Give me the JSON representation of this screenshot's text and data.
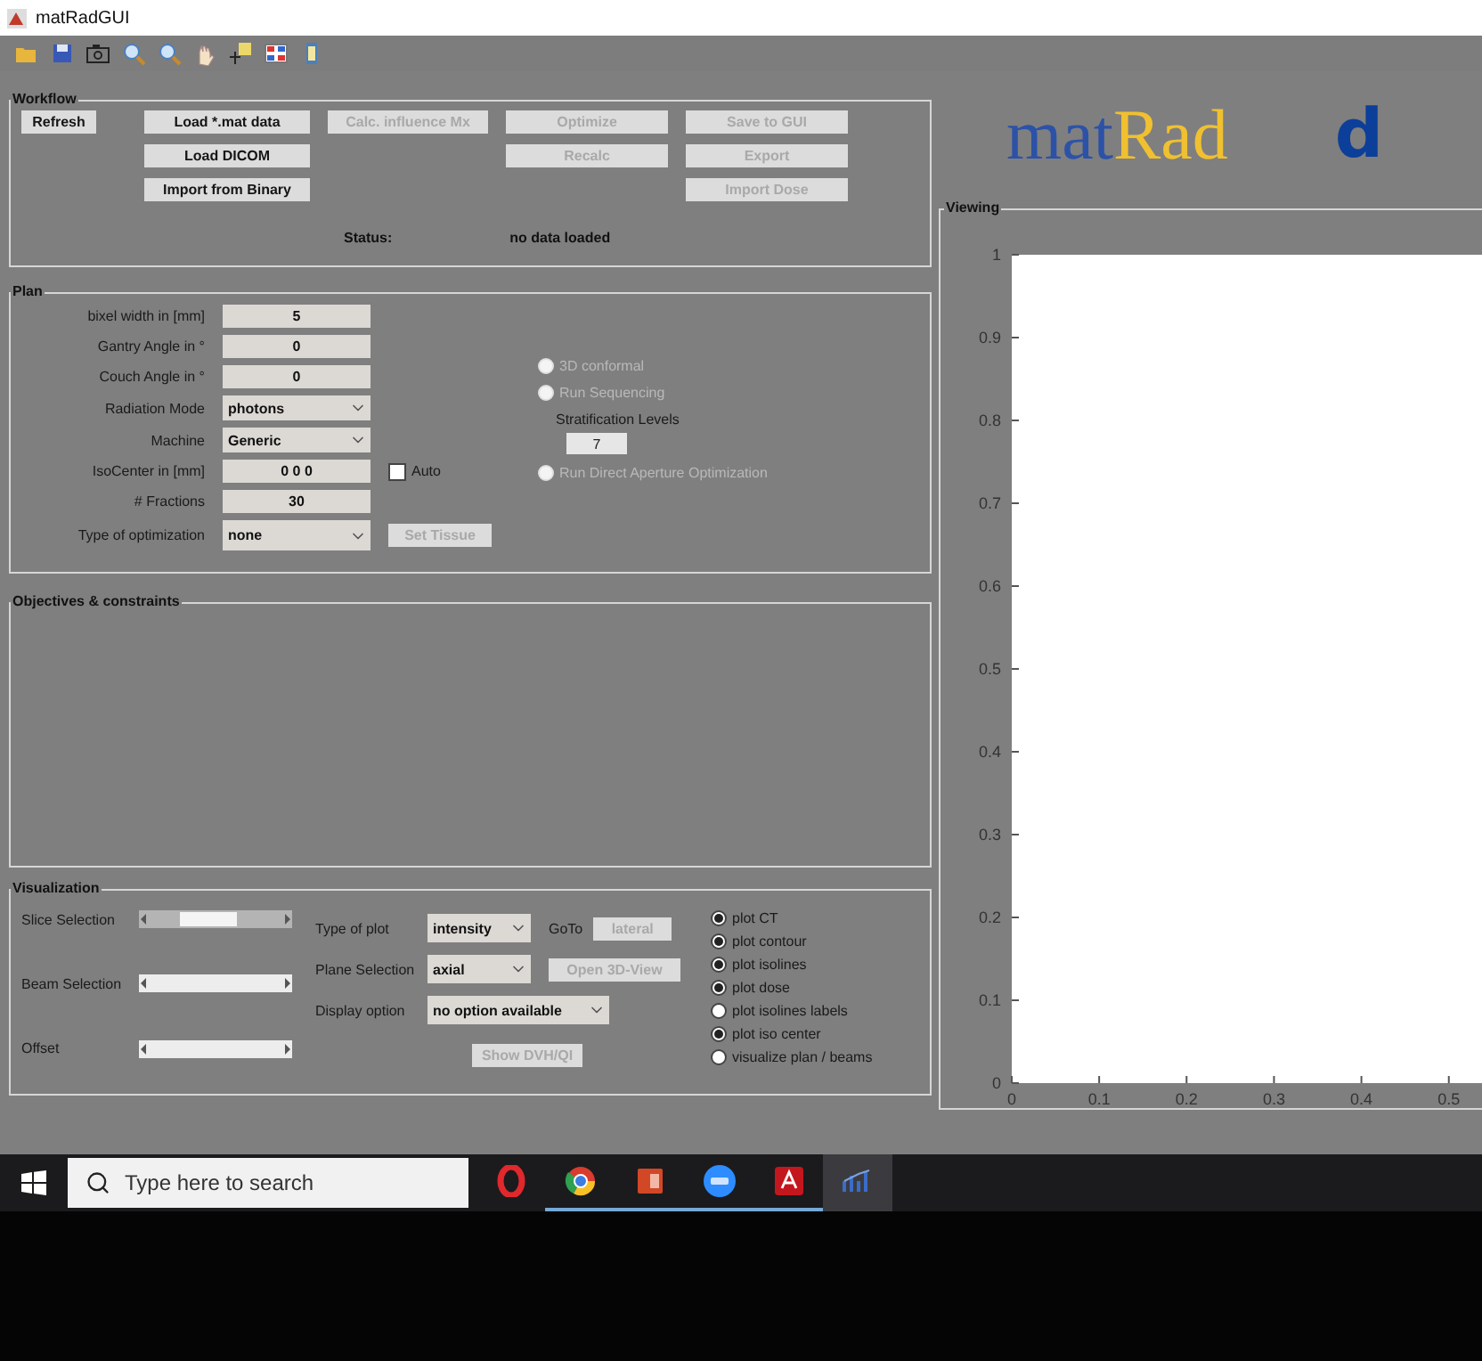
{
  "window": {
    "title": "matRadGUI"
  },
  "workflow": {
    "title": "Workflow",
    "columns": [
      [
        {
          "label": "Refresh",
          "disabled": false
        }
      ],
      [
        {
          "label": "Load *.mat data",
          "disabled": false
        },
        {
          "label": "Load DICOM",
          "disabled": false
        },
        {
          "label": "Import from Binary",
          "disabled": false
        }
      ],
      [
        {
          "label": "Calc. influence Mx",
          "disabled": true
        }
      ],
      [
        {
          "label": "Optimize",
          "disabled": true
        },
        {
          "label": "Recalc",
          "disabled": true
        }
      ],
      [
        {
          "label": "Save to GUI",
          "disabled": true
        },
        {
          "label": "Export",
          "disabled": true
        },
        {
          "label": "Import Dose",
          "disabled": true
        }
      ]
    ],
    "status_label": "Status:",
    "status": "no data loaded"
  },
  "plan": {
    "title": "Plan",
    "fields": [
      {
        "kind": "input",
        "label": "bixel width in [mm]",
        "value": "5"
      },
      {
        "kind": "input",
        "label": "Gantry Angle in °",
        "value": "0"
      },
      {
        "kind": "input",
        "label": "Couch Angle in °",
        "value": "0"
      },
      {
        "kind": "select",
        "label": "Radiation Mode",
        "value": "photons"
      },
      {
        "kind": "select",
        "label": "Machine",
        "value": "Generic"
      },
      {
        "kind": "input",
        "label": "IsoCenter in [mm]",
        "value": "0 0 0",
        "checkbox": {
          "label": "Auto",
          "checked": false
        }
      },
      {
        "kind": "input",
        "label": "# Fractions",
        "value": "30"
      },
      {
        "kind": "select",
        "label": "Type of optimization",
        "value": "none",
        "button": {
          "label": "Set Tissue",
          "disabled": true
        }
      }
    ],
    "options": [
      {
        "kind": "radio",
        "label": "3D conformal",
        "selected": false,
        "disabled": true
      },
      {
        "kind": "radio",
        "label": "Run Sequencing",
        "selected": false,
        "disabled": true
      },
      {
        "kind": "number",
        "label": "Stratification Levels",
        "value": "7"
      },
      {
        "kind": "radio",
        "label": "Run Direct Aperture Optimization",
        "selected": false,
        "disabled": true
      }
    ]
  },
  "objectives": {
    "title": "Objectives & constraints"
  },
  "visualization": {
    "title": "Visualization",
    "sliders": [
      {
        "label": "Slice Selection",
        "disabled": false,
        "level": 0.4
      },
      {
        "label": "Beam Selection",
        "disabled": true
      },
      {
        "label": "Offset",
        "disabled": true
      }
    ],
    "rows": [
      {
        "label": "Type of plot",
        "value": "intensity",
        "extra_label": "GoTo",
        "button": {
          "label": "lateral",
          "disabled": true
        }
      },
      {
        "label": "Plane Selection",
        "value": "axial",
        "button": {
          "label": "Open 3D-View",
          "disabled": true
        }
      },
      {
        "label": "Display option",
        "value": "no option available"
      }
    ],
    "dvh_button": {
      "label": "Show DVH/QI",
      "disabled": true
    },
    "plot_options": [
      {
        "label": "plot CT",
        "checked": true
      },
      {
        "label": "plot contour",
        "checked": true
      },
      {
        "label": "plot isolines",
        "checked": true
      },
      {
        "label": "plot dose",
        "checked": true
      },
      {
        "label": "plot isolines labels",
        "checked": false
      },
      {
        "label": "plot iso center",
        "checked": true
      },
      {
        "label": "visualize plan / beams",
        "checked": false
      }
    ]
  },
  "logo": {
    "parts": [
      "mat",
      "Rad"
    ],
    "partner": "d"
  },
  "viewing": {
    "title": "Viewing",
    "chart_data": {
      "type": "line",
      "xlim": [
        0,
        0.54
      ],
      "ylim": [
        0,
        1
      ],
      "xticks": [
        0,
        0.1,
        0.2,
        0.3,
        0.4,
        0.5
      ],
      "yticks": [
        0,
        0.1,
        0.2,
        0.3,
        0.4,
        0.5,
        0.6,
        0.7,
        0.8,
        0.9,
        1
      ]
    }
  },
  "taskbar": {
    "search": {
      "placeholder": "Type here to search"
    },
    "apps": [
      {
        "kind": "ring",
        "running": false,
        "active": false
      },
      {
        "kind": "browser",
        "running": true,
        "active": false
      },
      {
        "kind": "slides",
        "running": true,
        "active": false
      },
      {
        "kind": "video",
        "running": true,
        "active": false
      },
      {
        "kind": "pdf",
        "running": true,
        "active": false
      },
      {
        "kind": "matrad",
        "running": false,
        "active": true
      }
    ]
  }
}
